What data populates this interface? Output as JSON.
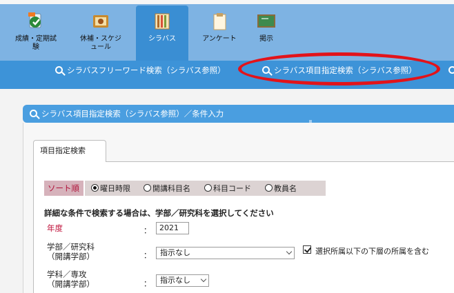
{
  "nav": {
    "items": [
      {
        "label": "成績・定期試験",
        "icon": "grade-icon"
      },
      {
        "label": "休補・スケジュール",
        "icon": "schedule-icon"
      },
      {
        "label": "シラバス",
        "icon": "syllabus-icon"
      },
      {
        "label": "アンケート",
        "icon": "survey-icon"
      },
      {
        "label": "掲示",
        "icon": "bulletin-icon"
      }
    ],
    "active": "シラバス"
  },
  "subnav": {
    "free_word": "シラバスフリーワード検索（シラバス参照）",
    "item_search": "シラバス項目指定検索（シラバス参照）"
  },
  "section": {
    "title": "シラバス項目指定検索（シラバス参照）／条件入力"
  },
  "tab": {
    "label": "項目指定検索"
  },
  "sort": {
    "label": "ソート順",
    "options": [
      "曜日時限",
      "開講科目名",
      "科目コード",
      "教員名"
    ],
    "selected": "曜日時限"
  },
  "form": {
    "instruction": "詳細な条件で検索する場合は、学部／研究科を選択してください",
    "year_label": "年度",
    "year_value": "2021",
    "faculty_label": "学部／研究科",
    "faculty_sub": "（開講学部）",
    "faculty_value": "指示なし",
    "include_sub_label": "選択所属以下の下層の所属を含む",
    "include_sub_checked": true,
    "dept_label": "学科／専攻",
    "dept_sub": "（開講学部）",
    "dept_value": "指示なし",
    "colon": "："
  },
  "colors": {
    "nav_bg": "#7eb3e3",
    "nav_active": "#3a8ed3",
    "subbar": "#3d93d8",
    "highlight_oval": "#e2131a",
    "label_red": "#c0143c"
  }
}
